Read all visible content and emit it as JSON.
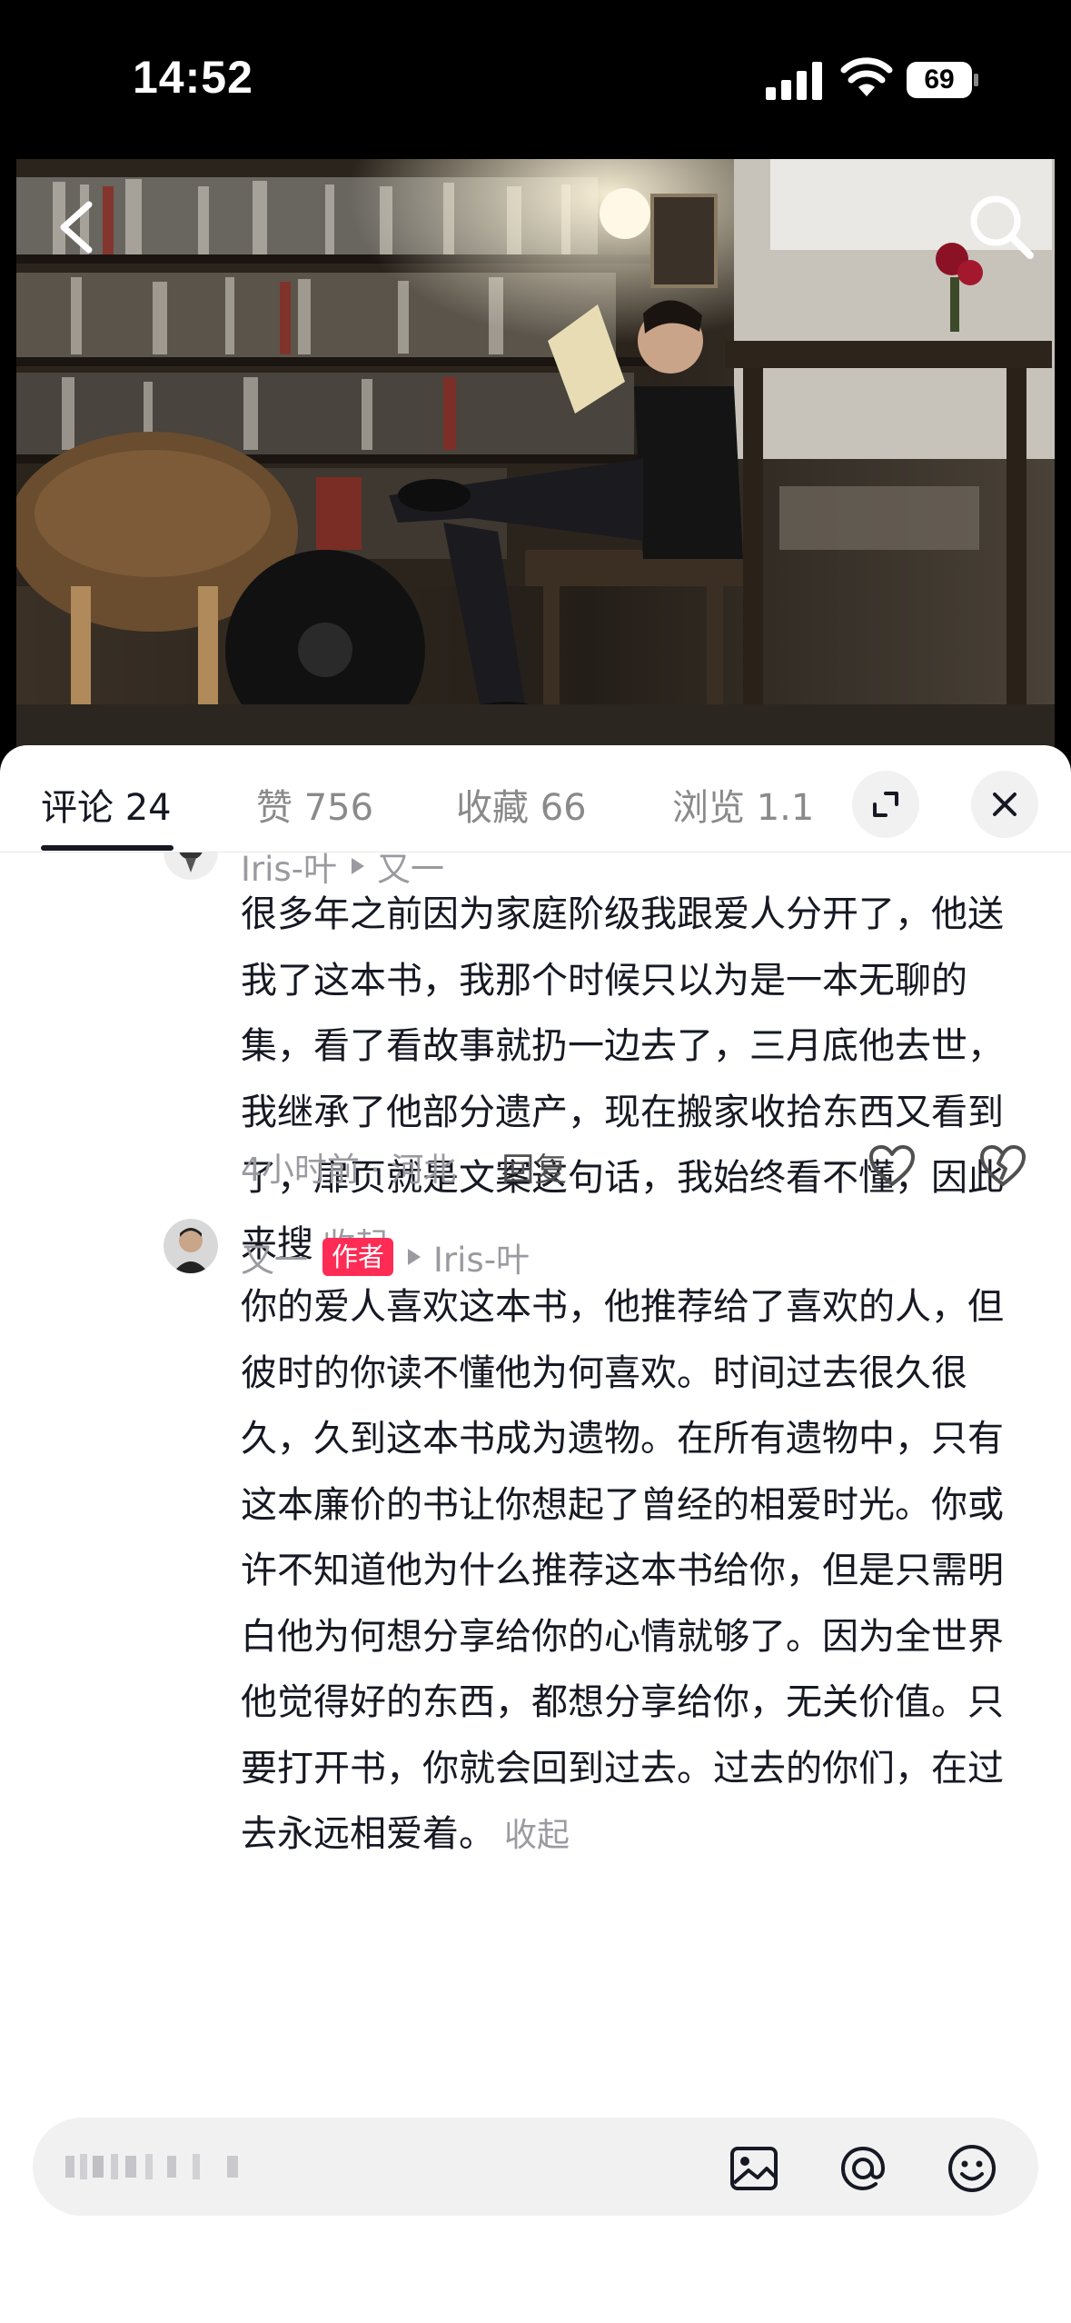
{
  "status_bar": {
    "time": "14:52",
    "battery": "69"
  },
  "video": {
    "back_icon": "chevron-left-icon",
    "search_icon": "search-icon"
  },
  "tabs": [
    {
      "label": "评论 24"
    },
    {
      "label": "赞 756"
    },
    {
      "label": "收藏 66"
    },
    {
      "label": "浏览 1.1"
    }
  ],
  "tab_icons": {
    "expand": "expand-icon",
    "close": "close-icon"
  },
  "comments": [
    {
      "user": "Iris-叶",
      "reply_to": "又一",
      "text": "很多年之前因为家庭阶级我跟爱人分开了，他送我了这本书，我那个时候只以为是一本无聊的集，看了看故事就扔一边去了，三月底他去世，我继承了他部分遗产，现在搬家收拾东西又看到了，扉页就是文案这句话，我始终看不懂，因此来搜",
      "fold": "收起",
      "time_location": "4小时前 · 河北",
      "reply": "回复"
    },
    {
      "user": "又一",
      "author_tag": "作者",
      "reply_to": "Iris-叶",
      "text": "你的爱人喜欢这本书，他推荐给了喜欢的人，但彼时的你读不懂他为何喜欢。时间过去很久很久，久到这本书成为遗物。在所有遗物中，只有这本廉价的书让你想起了曾经的相爱时光。你或许不知道他为什么推荐这本书给你，但是只需明白他为何想分享给你的心情就够了。因为全世界他觉得好的东西，都想分享给你，无关价值。只要打开书，你就会回到过去。过去的你们，在过去永远相爱着。",
      "fold": "收起"
    }
  ],
  "input": {
    "placeholder": "",
    "icons": [
      "image-icon",
      "at-icon",
      "emoji-icon"
    ]
  },
  "colors": {
    "accent": "#fe2c55",
    "text": "#161823",
    "muted": "#9a9aa0",
    "sheet_bg": "#ffffff"
  }
}
